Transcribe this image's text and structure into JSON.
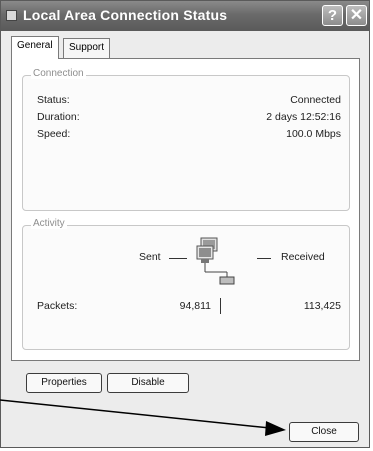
{
  "window": {
    "title": "Local Area Connection Status"
  },
  "tabs": [
    {
      "label": "General"
    },
    {
      "label": "Support"
    }
  ],
  "connection": {
    "legend": "Connection",
    "rows": [
      {
        "label": "Status:",
        "value": "Connected"
      },
      {
        "label": "Duration:",
        "value": "2 days 12:52:16"
      },
      {
        "label": "Speed:",
        "value": "100.0 Mbps"
      }
    ]
  },
  "activity": {
    "legend": "Activity",
    "sent_label": "Sent",
    "received_label": "Received",
    "packets_label": "Packets:",
    "packets_sent": "94,811",
    "packets_received": "113,425"
  },
  "buttons": {
    "properties": "Properties",
    "disable": "Disable",
    "close": "Close"
  }
}
